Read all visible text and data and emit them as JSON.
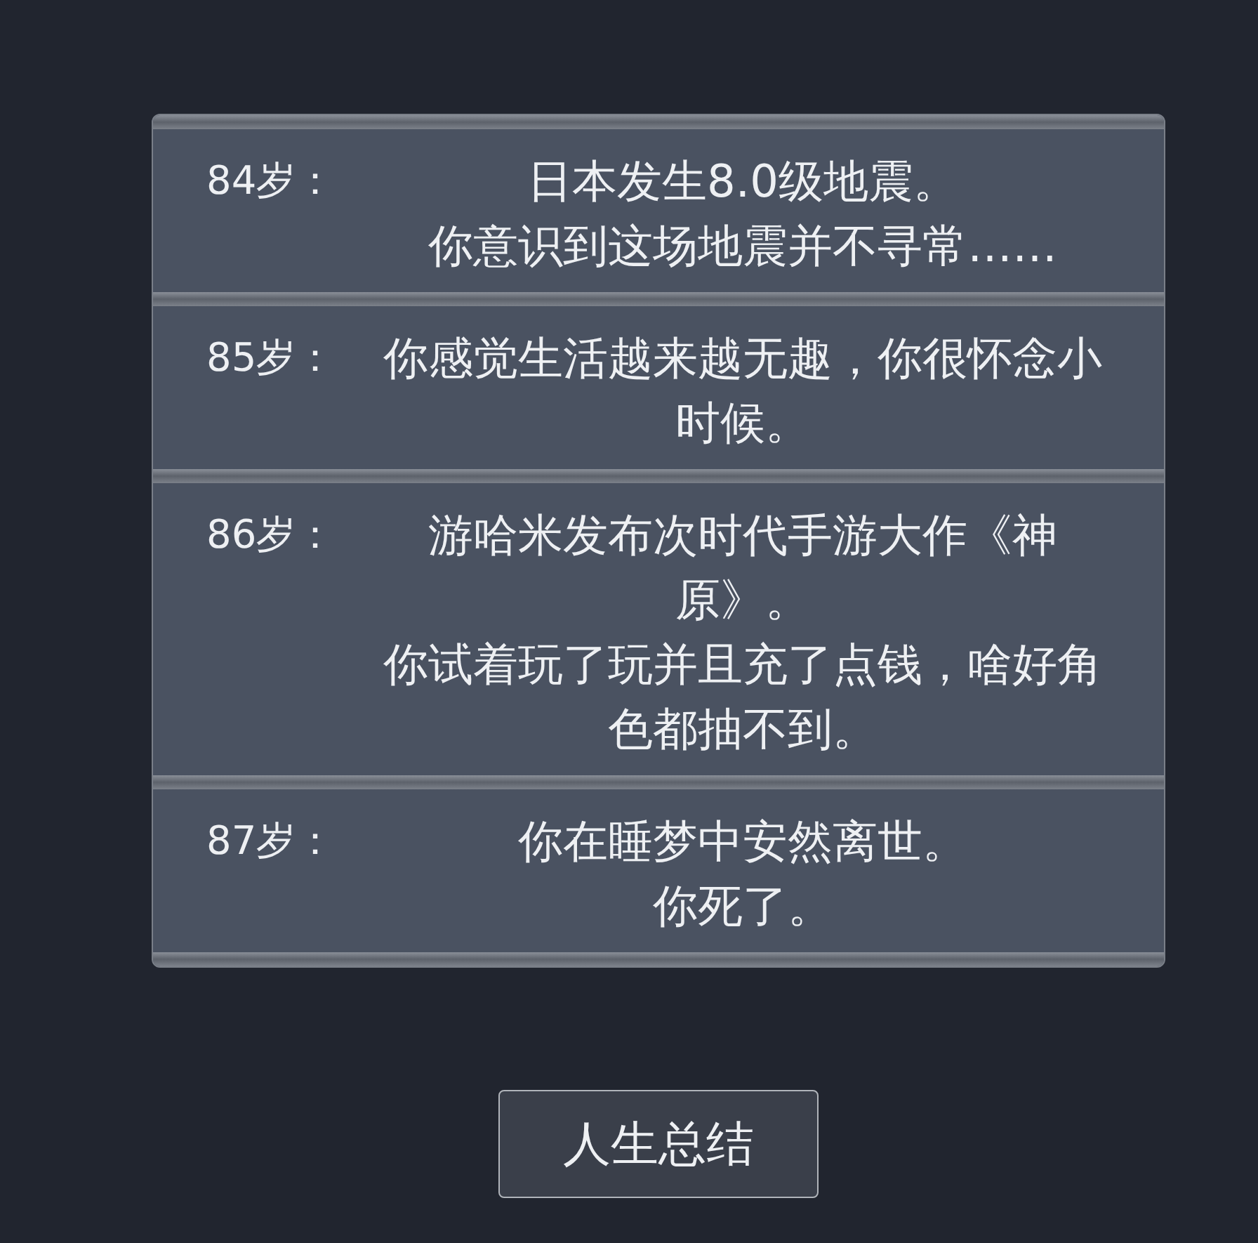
{
  "entries": [
    {
      "age": "84岁：",
      "paragraphs": [
        "日本发生8.0级地震。",
        "你意识到这场地震并不寻常……"
      ]
    },
    {
      "age": "85岁：",
      "paragraphs": [
        "你感觉生活越来越无趣，你很怀念小时候。"
      ]
    },
    {
      "age": "86岁：",
      "paragraphs": [
        "游哈米发布次时代手游大作《神原》。",
        "你试着玩了玩并且充了点钱，啥好角色都抽不到。"
      ]
    },
    {
      "age": "87岁：",
      "paragraphs": [
        "你在睡梦中安然离世。",
        "你死了。"
      ]
    }
  ],
  "button": "人生总结"
}
